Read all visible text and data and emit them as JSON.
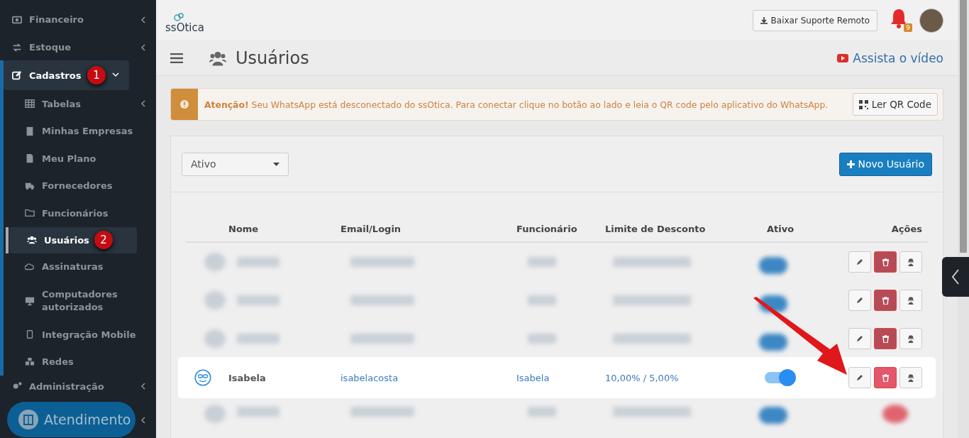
{
  "sidebar": {
    "items": [
      {
        "label": "Financeiro",
        "expanded": false,
        "selected": false
      },
      {
        "label": "Estoque",
        "expanded": false,
        "selected": false
      },
      {
        "label": "Cadastros",
        "expanded": true,
        "selected": true,
        "badge": "1",
        "children": [
          {
            "label": "Tabelas",
            "expanded": false,
            "selected": false
          },
          {
            "label": "Minhas Empresas",
            "selected": false
          },
          {
            "label": "Meu Plano",
            "selected": false
          },
          {
            "label": "Fornecedores",
            "selected": false
          },
          {
            "label": "Funcionários",
            "selected": false
          },
          {
            "label": "Usuários",
            "selected": true,
            "badge": "2"
          },
          {
            "label": "Assinaturas",
            "selected": false
          },
          {
            "label": "Computadores autorizados",
            "selected": false
          },
          {
            "label": "Integração Mobile",
            "selected": false
          },
          {
            "label": "Redes",
            "selected": false
          }
        ]
      },
      {
        "label": "Administração",
        "expanded": false,
        "selected": false
      }
    ],
    "support_button": "Atendimento"
  },
  "topbar": {
    "logo": "ssOtica",
    "download_button": "Baixar Suporte Remoto",
    "notification_count": "9"
  },
  "page_header": {
    "title": "Usuários",
    "video_link": "Assista o vídeo"
  },
  "alert": {
    "message": "**Atenção!** Seu WhatsApp está desconectado do ssOtica. Para conectar clique no botão ao lado e leia o QR code pelo aplicativo do WhatsApp.",
    "button": "Ler QR Code"
  },
  "users": {
    "filter": {
      "value": "Ativo"
    },
    "new_button": "Novo Usuário",
    "columns": [
      "Nome",
      "Email/Login",
      "Funcionário",
      "Limite de Desconto",
      "Ativo",
      "Ações"
    ],
    "rows": [
      {
        "kind": "blurred"
      },
      {
        "kind": "blurred"
      },
      {
        "kind": "blurred"
      },
      {
        "kind": "user",
        "name": "Isabela",
        "login": "isabelacosta",
        "employee": "Isabela",
        "discount": "10,00% / 5,00%",
        "active": true,
        "highlighted": true
      },
      {
        "kind": "blurred_full"
      }
    ]
  }
}
